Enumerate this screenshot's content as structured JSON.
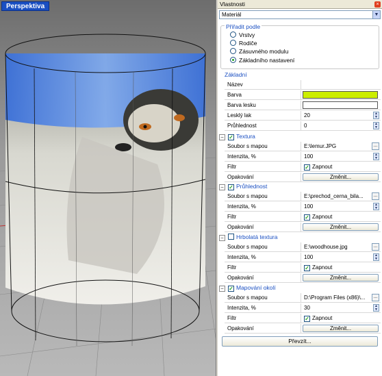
{
  "viewport": {
    "title": "Perspektiva"
  },
  "panel": {
    "title": "Vlastnosti",
    "close_icon": "close-icon",
    "category": "Materiál",
    "assign_group": {
      "label": "Přiřadit podle",
      "options": [
        "Vrstvy",
        "Rodiče",
        "Zásuvného modulu",
        "Základního nastavení"
      ],
      "selected": "Základního nastavení"
    },
    "basic": {
      "label": "Základní",
      "rows": [
        {
          "label": "Název",
          "value": ""
        },
        {
          "label": "Barva",
          "value": "",
          "color": "#ccee00"
        },
        {
          "label": "Barva lesku",
          "value": "",
          "color": "#ffffff"
        },
        {
          "label": "Lesklý lak",
          "value": "20"
        },
        {
          "label": "Průhlednost",
          "value": "0"
        }
      ]
    },
    "sections": [
      {
        "title": "Textura",
        "checked": true,
        "file_label": "Soubor s mapou",
        "file": "E:\\lemur.JPG",
        "intensity_label": "Intenzita, %",
        "intensity": "100",
        "filter_label": "Filtr",
        "filter_value": "Zapnout",
        "repeat_label": "Opakování",
        "repeat_button": "Změnit..."
      },
      {
        "title": "Průhlednost",
        "checked": true,
        "file_label": "Soubor s mapou",
        "file": "E:\\prechod_cerna_bila...",
        "intensity_label": "Intenzita, %",
        "intensity": "100",
        "filter_label": "Filtr",
        "filter_value": "Zapnout",
        "repeat_label": "Opakování",
        "repeat_button": "Změnit..."
      },
      {
        "title": "Hrbolatá textura",
        "checked": false,
        "file_label": "Soubor s mapou",
        "file": "E:\\woodhouse.jpg",
        "intensity_label": "Intenzita, %",
        "intensity": "100",
        "filter_label": "Filtr",
        "filter_value": "Zapnout",
        "repeat_label": "Opakování",
        "repeat_button": "Změnit..."
      },
      {
        "title": "Mapování okolí",
        "checked": true,
        "file_label": "Soubor s mapou",
        "file": "D:\\Program Files (x86)\\...",
        "intensity_label": "Intenzita, %",
        "intensity": "30",
        "filter_label": "Filtr",
        "filter_value": "Zapnout",
        "repeat_label": "Opakování",
        "repeat_button": "Změnit..."
      }
    ],
    "take_over_button": "Převzít..."
  }
}
